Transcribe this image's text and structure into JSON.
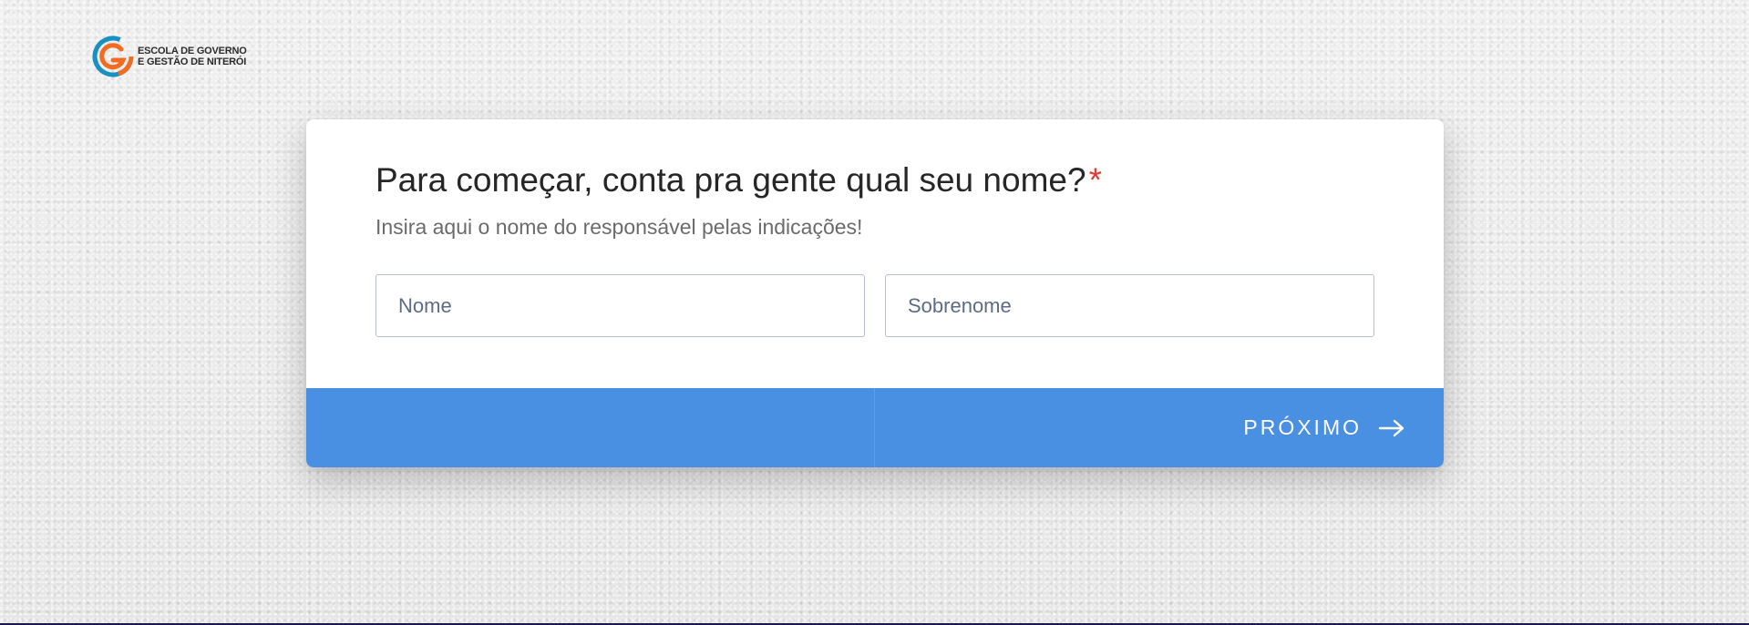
{
  "logo": {
    "line1": "ESCOLA DE GOVERNO",
    "line2": "E GESTÃO DE NITERÓI",
    "colors": {
      "outer": "#1a8fc2",
      "inner": "#f26b21"
    }
  },
  "form": {
    "question": "Para começar, conta pra gente qual seu nome?",
    "required_mark": "*",
    "subtitle": "Insira aqui o nome do responsável pelas indicações!",
    "first_name": {
      "placeholder": "Nome",
      "value": ""
    },
    "last_name": {
      "placeholder": "Sobrenome",
      "value": ""
    }
  },
  "footer": {
    "next_label": "PRÓXIMO",
    "next_icon": "arrow-right-icon"
  },
  "colors": {
    "accent": "#4a90e2",
    "required": "#e53935",
    "background": "#ececec"
  }
}
